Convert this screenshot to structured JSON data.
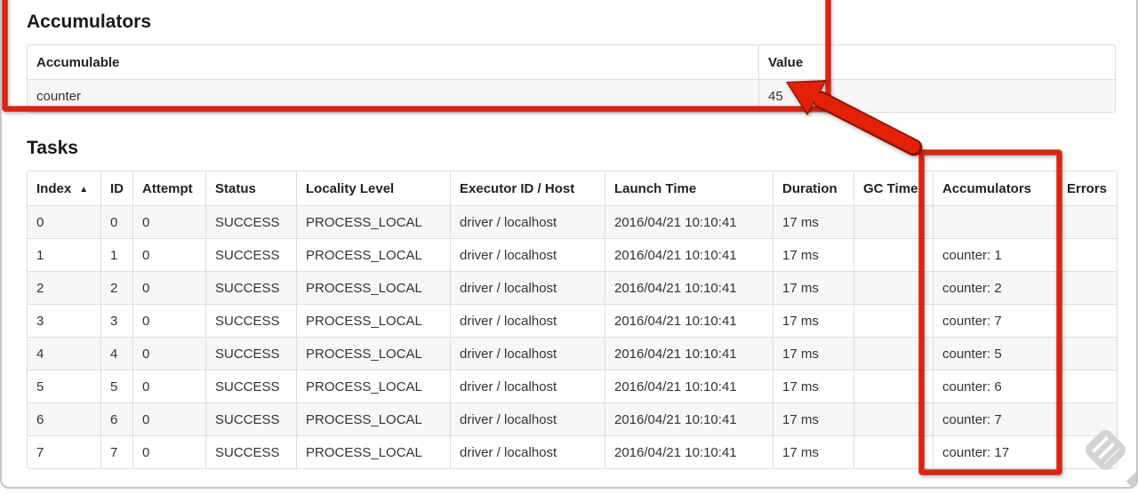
{
  "annotation": {
    "color": "#e32109",
    "outline": "#8c0f02"
  },
  "watermark_name": "skitch-badge",
  "accumulators": {
    "title": "Accumulators",
    "headers": {
      "accumulable": "Accumulable",
      "value": "Value"
    },
    "rows": [
      {
        "accumulable": "counter",
        "value": "45"
      }
    ]
  },
  "tasks": {
    "title": "Tasks",
    "sort_icon": "▲",
    "headers": [
      "Index",
      "ID",
      "Attempt",
      "Status",
      "Locality Level",
      "Executor ID / Host",
      "Launch Time",
      "Duration",
      "GC Time",
      "Accumulators",
      "Errors"
    ],
    "rows": [
      {
        "index": "0",
        "id": "0",
        "attempt": "0",
        "status": "SUCCESS",
        "locality": "PROCESS_LOCAL",
        "executor": "driver / localhost",
        "launch": "2016/04/21 10:10:41",
        "duration": "17 ms",
        "gc": "",
        "accumulators": "",
        "errors": ""
      },
      {
        "index": "1",
        "id": "1",
        "attempt": "0",
        "status": "SUCCESS",
        "locality": "PROCESS_LOCAL",
        "executor": "driver / localhost",
        "launch": "2016/04/21 10:10:41",
        "duration": "17 ms",
        "gc": "",
        "accumulators": "counter: 1",
        "errors": ""
      },
      {
        "index": "2",
        "id": "2",
        "attempt": "0",
        "status": "SUCCESS",
        "locality": "PROCESS_LOCAL",
        "executor": "driver / localhost",
        "launch": "2016/04/21 10:10:41",
        "duration": "17 ms",
        "gc": "",
        "accumulators": "counter: 2",
        "errors": ""
      },
      {
        "index": "3",
        "id": "3",
        "attempt": "0",
        "status": "SUCCESS",
        "locality": "PROCESS_LOCAL",
        "executor": "driver / localhost",
        "launch": "2016/04/21 10:10:41",
        "duration": "17 ms",
        "gc": "",
        "accumulators": "counter: 7",
        "errors": ""
      },
      {
        "index": "4",
        "id": "4",
        "attempt": "0",
        "status": "SUCCESS",
        "locality": "PROCESS_LOCAL",
        "executor": "driver / localhost",
        "launch": "2016/04/21 10:10:41",
        "duration": "17 ms",
        "gc": "",
        "accumulators": "counter: 5",
        "errors": ""
      },
      {
        "index": "5",
        "id": "5",
        "attempt": "0",
        "status": "SUCCESS",
        "locality": "PROCESS_LOCAL",
        "executor": "driver / localhost",
        "launch": "2016/04/21 10:10:41",
        "duration": "17 ms",
        "gc": "",
        "accumulators": "counter: 6",
        "errors": ""
      },
      {
        "index": "6",
        "id": "6",
        "attempt": "0",
        "status": "SUCCESS",
        "locality": "PROCESS_LOCAL",
        "executor": "driver / localhost",
        "launch": "2016/04/21 10:10:41",
        "duration": "17 ms",
        "gc": "",
        "accumulators": "counter: 7",
        "errors": ""
      },
      {
        "index": "7",
        "id": "7",
        "attempt": "0",
        "status": "SUCCESS",
        "locality": "PROCESS_LOCAL",
        "executor": "driver / localhost",
        "launch": "2016/04/21 10:10:41",
        "duration": "17 ms",
        "gc": "",
        "accumulators": "counter: 17",
        "errors": ""
      }
    ]
  }
}
